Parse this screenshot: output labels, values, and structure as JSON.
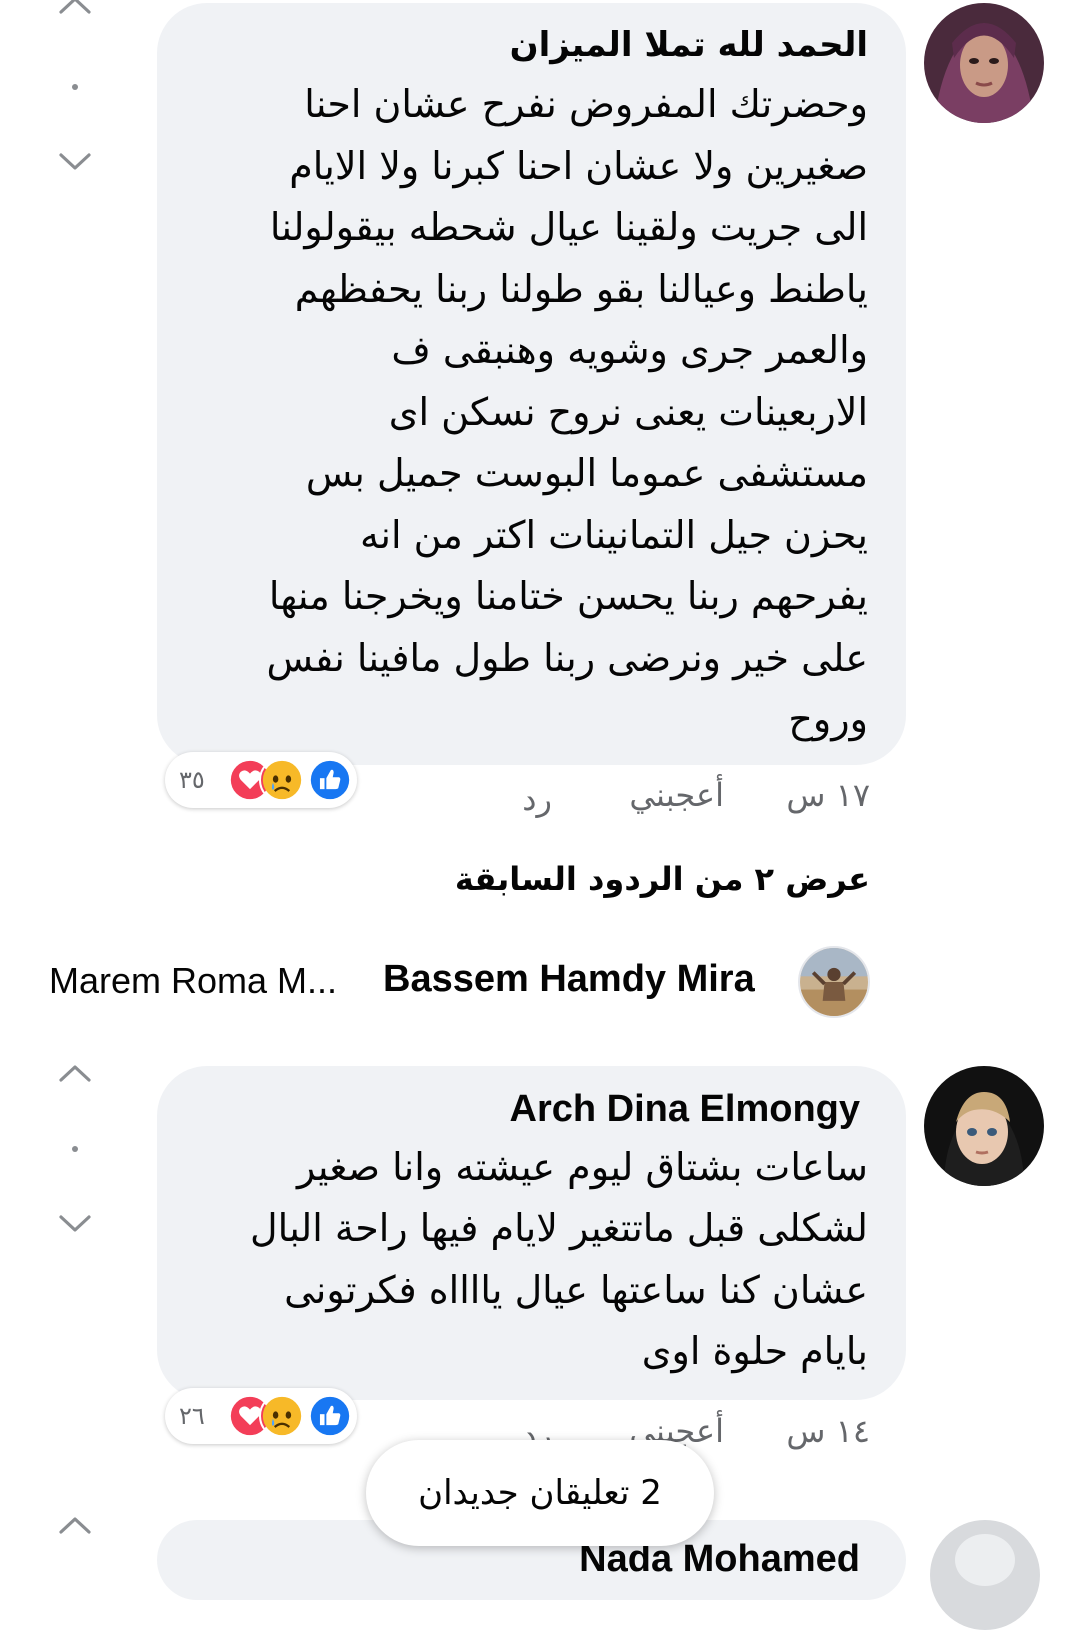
{
  "comments": [
    {
      "author": "الحمد لله تملا الميزان",
      "lines": [
        "وحضرتك المفروض نفرح عشان احنا",
        "صغيرين ولا عشان احنا كبرنا ولا الايام",
        "الى جريت ولقينا عيال شحطه بيقولولنا",
        "ياطنط وعيالنا بقو طولنا ربنا يحفظهم",
        "والعمر جرى وشويه وهنبقى ف",
        "الاربعينات يعنى نروح نسكن اى",
        "مستشفى عموما البوست جميل بس",
        "يحزن جيل التمانينات اكتر من انه",
        "يفرحهم ربنا يحسن ختامنا ويخرجنا منها",
        "على خير ونرضى ربنا طول مافينا نفس",
        "وروح"
      ],
      "time": "١٧ س",
      "like_label": "أعجبني",
      "reply_label": "رد",
      "reaction_count": "٣٥"
    },
    {
      "author": "Arch Dina Elmongy",
      "lines": [
        "ساعات بشتاق ليوم عيشته وانا صغير",
        "لشكلى قبل ماتتغير لايام فيها راحة البال",
        "عشان كنا ساعتها عيال يااااه فكرتونى",
        "بايام حلوة اوى"
      ],
      "time": "١٤ س",
      "like_label": "أعجبني",
      "reply_label": "رد",
      "reaction_count": "٢٦"
    }
  ],
  "view_previous_replies": "عرض ٢ من الردود السابقة",
  "reply_row": {
    "name": "Bassem Hamdy Mira",
    "mention": "Marem Roma M..."
  },
  "third_comment_author_partial": "Nada Mohamed",
  "new_comments_pill": "2 تعليقان جديدان",
  "icons": [
    "chevron-up-icon",
    "chevron-down-icon",
    "like-reaction-icon",
    "sad-reaction-icon",
    "love-reaction-icon"
  ],
  "colors": {
    "bubble": "#f0f2f5",
    "like_blue": "#1877f2",
    "love_red": "#f33e58",
    "sad_yellow": "#f7b928",
    "meta_gray": "#65676b"
  }
}
